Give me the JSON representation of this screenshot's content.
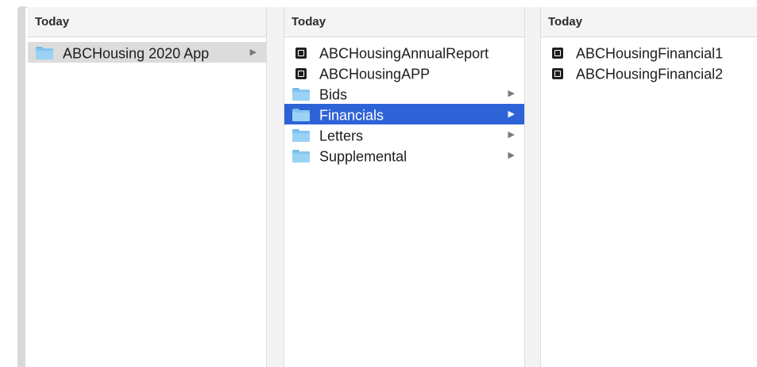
{
  "columns": [
    {
      "header": "Today",
      "items": [
        {
          "label": "ABCHousing 2020 App",
          "icon": "folder-icon",
          "chevron": "▶"
        }
      ]
    },
    {
      "header": "Today",
      "items": [
        {
          "label": "ABCHousingAnnualReport",
          "icon": "pdf-icon"
        },
        {
          "label": "ABCHousingAPP",
          "icon": "pdf-icon"
        },
        {
          "label": "Bids",
          "icon": "folder-icon",
          "chevron": "▶"
        },
        {
          "label": "Financials",
          "icon": "folder-icon",
          "chevron": "▶"
        },
        {
          "label": "Letters",
          "icon": "folder-icon",
          "chevron": "▶"
        },
        {
          "label": "Supplemental",
          "icon": "folder-icon",
          "chevron": "▶"
        }
      ]
    },
    {
      "header": "Today",
      "items": [
        {
          "label": "ABCHousingFinancial1",
          "icon": "pdf-icon"
        },
        {
          "label": "ABCHousingFinancial2",
          "icon": "pdf-icon"
        }
      ]
    }
  ],
  "colors": {
    "selection_active": "#2d63d6",
    "selection_inactive": "#dcdcdc",
    "folder": "#83c5f0"
  }
}
